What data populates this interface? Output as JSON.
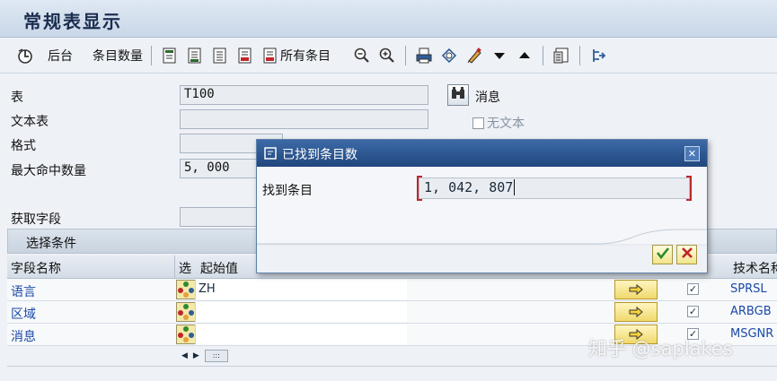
{
  "window": {
    "title": "常规表显示"
  },
  "toolbar": {
    "background_label": "后台",
    "entry_count_label": "条目数量",
    "all_entries_label": "所有条目"
  },
  "form": {
    "table_label": "表",
    "table_value": "T100",
    "text_table_label": "文本表",
    "text_table_value": "",
    "format_label": "格式",
    "format_value": "",
    "max_hits_label": "最大命中数量",
    "max_hits_value": "5, 000",
    "get_fields_label": "获取字段",
    "message_label": "消息",
    "no_text_label": "无文本"
  },
  "selection": {
    "header": "选择条件",
    "columns": {
      "field_name": "字段名称",
      "select": "选",
      "start_value": "起始值",
      "tech_name": "技术名称"
    },
    "rows": [
      {
        "field": "语言",
        "start": "ZH",
        "tech": "SPRSL",
        "checked": true
      },
      {
        "field": "区域",
        "start": "",
        "tech": "ARBGB",
        "checked": true
      },
      {
        "field": "消息",
        "start": "",
        "tech": "MSGNR",
        "checked": true
      }
    ]
  },
  "dialog": {
    "title": "已找到条目数",
    "found_label": "找到条目",
    "found_value": "1, 042, 807"
  },
  "watermark": "知乎 @saplakes",
  "colors": {
    "title_blue": "#1a2d4f",
    "dialog_header": "#21467d",
    "link_blue": "#1b49a6"
  }
}
